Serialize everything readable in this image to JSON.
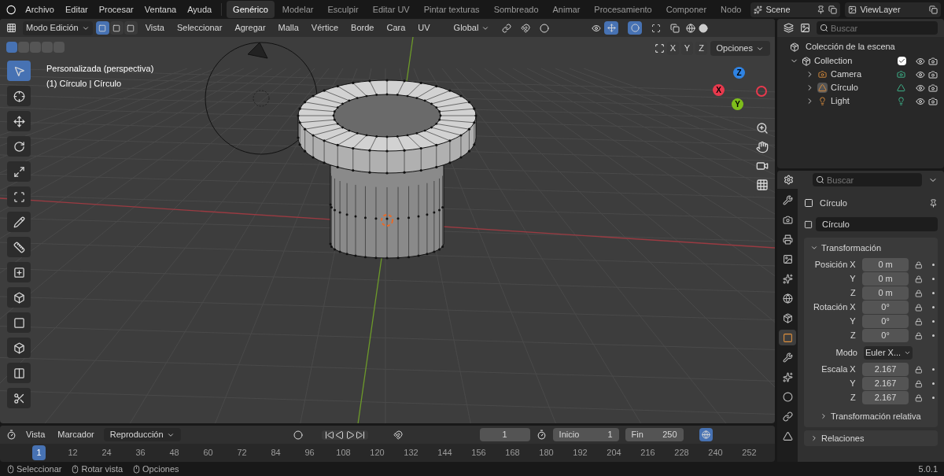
{
  "menus": [
    "Archivo",
    "Editar",
    "Procesar",
    "Ventana",
    "Ayuda"
  ],
  "workspaces": [
    {
      "label": "Genérico",
      "selected": true
    },
    {
      "label": "Modelar",
      "selected": false
    },
    {
      "label": "Esculpir",
      "selected": false
    },
    {
      "label": "Editar UV",
      "selected": false
    },
    {
      "label": "Pintar texturas",
      "selected": false
    },
    {
      "label": "Sombreado",
      "selected": false
    },
    {
      "label": "Animar",
      "selected": false
    },
    {
      "label": "Procesamiento",
      "selected": false
    },
    {
      "label": "Componer",
      "selected": false
    },
    {
      "label": "Nodo",
      "selected": false
    }
  ],
  "scene": {
    "name": "Scene"
  },
  "view_layer": {
    "name": "ViewLayer"
  },
  "viewport": {
    "mode": "Modo Edición",
    "select_modes": [
      {
        "selected": true
      },
      {
        "selected": false
      },
      {
        "selected": false
      }
    ],
    "menus": [
      "Vista",
      "Seleccionar",
      "Agregar",
      "Malla",
      "Vértice",
      "Borde",
      "Cara",
      "UV"
    ],
    "orientation": "Global",
    "mirror_axes": [
      "X",
      "Y",
      "Z"
    ],
    "options": "Opciones",
    "view_name": "Personalizada (perspectiva)",
    "object_info": "(1) Círculo | Círculo",
    "gizmo": [
      {
        "label": "Z",
        "color": "#2f83e3"
      },
      {
        "label": "X",
        "color": "#e8394d"
      },
      {
        "label": "Y",
        "color": "#7ebd1b"
      }
    ],
    "tools": [
      {
        "kind": "select",
        "selected": true
      },
      {
        "kind": "cursor",
        "selected": false
      },
      {
        "kind": "move",
        "selected": false
      },
      {
        "kind": "rotate",
        "selected": false
      },
      {
        "kind": "scale",
        "selected": false
      },
      {
        "kind": "transform",
        "selected": false
      },
      {
        "kind": "annotate",
        "selected": false
      },
      {
        "kind": "measure",
        "selected": false
      },
      {
        "kind": "add",
        "selected": false
      },
      {
        "kind": "extrude",
        "selected": false
      },
      {
        "kind": "inset",
        "selected": false
      },
      {
        "kind": "bevel",
        "selected": false
      },
      {
        "kind": "loopcut",
        "selected": false
      },
      {
        "kind": "knife",
        "selected": false
      }
    ]
  },
  "outliner": {
    "search": {
      "placeholder": "Buscar"
    },
    "root": "Colección de la escena",
    "tree": [
      {
        "label": "Collection",
        "kind": "collection",
        "expanded": true,
        "checked": true,
        "children": [
          {
            "label": "Camera",
            "kind": "camera",
            "selected": false,
            "expanded": false
          },
          {
            "label": "Círculo",
            "kind": "mesh",
            "selected": true,
            "expanded": false
          },
          {
            "label": "Light",
            "kind": "light",
            "selected": false,
            "expanded": false
          }
        ]
      }
    ]
  },
  "properties": {
    "search": {
      "placeholder": "Buscar"
    },
    "title": "Círculo",
    "data_name": "Círculo",
    "tabs": [
      {
        "kind": "tool",
        "selected": false
      },
      {
        "kind": "render",
        "selected": false
      },
      {
        "kind": "output",
        "selected": false
      },
      {
        "kind": "view_layer",
        "selected": false
      },
      {
        "kind": "scene",
        "selected": false
      },
      {
        "kind": "world",
        "selected": false
      },
      {
        "kind": "collection",
        "selected": false
      },
      {
        "kind": "object",
        "selected": true
      },
      {
        "kind": "modifiers",
        "selected": false
      },
      {
        "kind": "particles",
        "selected": false
      },
      {
        "kind": "physics",
        "selected": false
      },
      {
        "kind": "constraints",
        "selected": false
      },
      {
        "kind": "data",
        "selected": false
      }
    ],
    "panel": {
      "title": "Transformación",
      "expanded": true,
      "groups": [
        {
          "label": "Posición",
          "rows": [
            {
              "axis": "X",
              "value": "0 m"
            },
            {
              "axis": "Y",
              "value": "0 m"
            },
            {
              "axis": "Z",
              "value": "0 m"
            }
          ]
        },
        {
          "label": "Rotación",
          "rows": [
            {
              "axis": "X",
              "value": "0°"
            },
            {
              "axis": "Y",
              "value": "0°"
            },
            {
              "axis": "Z",
              "value": "0°"
            }
          ]
        },
        {
          "label": "Modo",
          "dropdown": "Euler X..."
        },
        {
          "label": "Escala",
          "rows": [
            {
              "axis": "X",
              "value": "2.167"
            },
            {
              "axis": "Y",
              "value": "2.167"
            },
            {
              "axis": "Z",
              "value": "2.167"
            }
          ]
        }
      ],
      "subpanel": "Transformación relativa"
    },
    "collapsed": [
      "Relaciones"
    ]
  },
  "timeline": {
    "menus": [
      "Vista",
      "Marcador"
    ],
    "playback": "Reproducción",
    "current_frame": "1",
    "start_label": "Inicio",
    "start": "1",
    "end_label": "Fin",
    "end": "250",
    "ruler": [
      {
        "label": "1",
        "selected": true
      },
      {
        "label": "12",
        "selected": false
      },
      {
        "label": "24",
        "selected": false
      },
      {
        "label": "36",
        "selected": false
      },
      {
        "label": "48",
        "selected": false
      },
      {
        "label": "60",
        "selected": false
      },
      {
        "label": "72",
        "selected": false
      },
      {
        "label": "84",
        "selected": false
      },
      {
        "label": "96",
        "selected": false
      },
      {
        "label": "108",
        "selected": false
      },
      {
        "label": "120",
        "selected": false
      },
      {
        "label": "132",
        "selected": false
      },
      {
        "label": "144",
        "selected": false
      },
      {
        "label": "156",
        "selected": false
      },
      {
        "label": "168",
        "selected": false
      },
      {
        "label": "180",
        "selected": false
      },
      {
        "label": "192",
        "selected": false
      },
      {
        "label": "204",
        "selected": false
      },
      {
        "label": "216",
        "selected": false
      },
      {
        "label": "228",
        "selected": false
      },
      {
        "label": "240",
        "selected": false
      },
      {
        "label": "252",
        "selected": false
      }
    ]
  },
  "status": {
    "hints": [
      "Seleccionar",
      "Rotar vista",
      "Opciones"
    ],
    "version": "5.0.1"
  }
}
